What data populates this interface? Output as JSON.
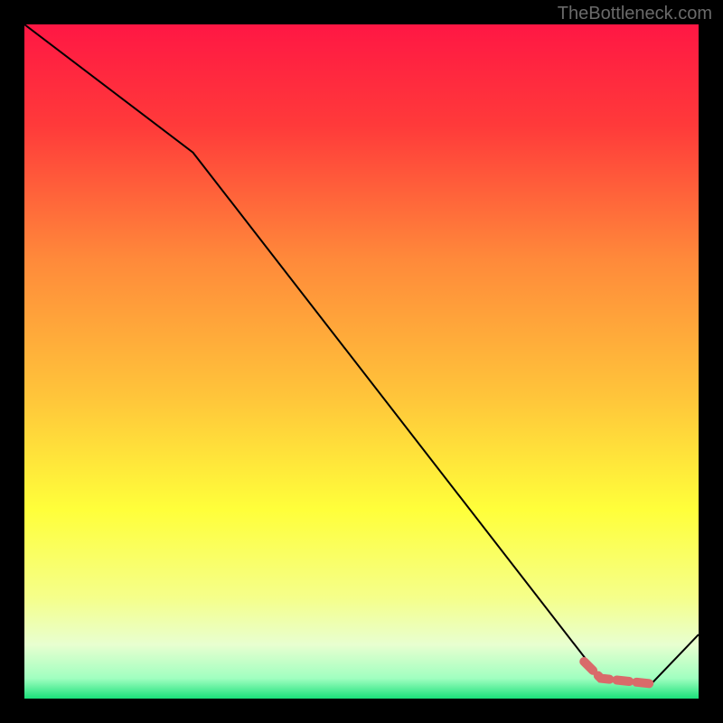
{
  "watermark": "TheBottleneck.com",
  "chart_data": {
    "type": "line",
    "title": "",
    "xlabel": "",
    "ylabel": "",
    "xlim": [
      0,
      10
    ],
    "ylim": [
      0,
      10
    ],
    "grid": false,
    "gradient_stops": [
      {
        "offset": 0,
        "color": "#ff1744"
      },
      {
        "offset": 0.15,
        "color": "#ff3a3a"
      },
      {
        "offset": 0.35,
        "color": "#ff8a3a"
      },
      {
        "offset": 0.55,
        "color": "#ffc43a"
      },
      {
        "offset": 0.72,
        "color": "#ffff3a"
      },
      {
        "offset": 0.85,
        "color": "#f5ff8a"
      },
      {
        "offset": 0.92,
        "color": "#e8ffd0"
      },
      {
        "offset": 0.97,
        "color": "#a0ffc0"
      },
      {
        "offset": 1.0,
        "color": "#1ae07a"
      }
    ],
    "series": [
      {
        "name": "main-line",
        "color": "#000000",
        "points": [
          {
            "x": 0.0,
            "y": 10.0
          },
          {
            "x": 2.5,
            "y": 8.1
          },
          {
            "x": 8.55,
            "y": 0.3
          },
          {
            "x": 9.3,
            "y": 0.22
          },
          {
            "x": 10.0,
            "y": 0.95
          }
        ]
      },
      {
        "name": "highlight-segment",
        "color": "#d96a6a",
        "width": 10,
        "dash": true,
        "points": [
          {
            "x": 8.3,
            "y": 0.55
          },
          {
            "x": 8.55,
            "y": 0.3
          },
          {
            "x": 9.3,
            "y": 0.22
          }
        ]
      }
    ]
  }
}
